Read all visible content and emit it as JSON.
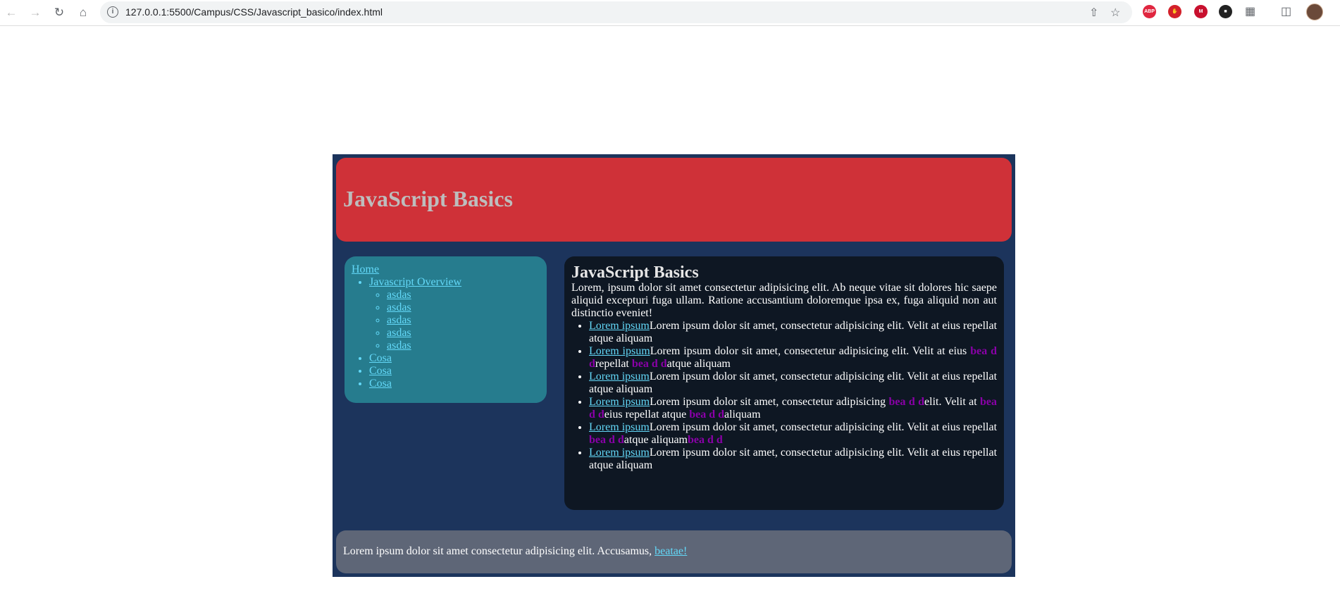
{
  "browser": {
    "url": "127.0.0.1:5500/Campus/CSS/Javascript_basico/index.html"
  },
  "page": {
    "header_title": "JavaScript Basics",
    "sidebar": {
      "home": "Home",
      "overview": "Javascript Overview",
      "subitems": [
        "asdas",
        "asdas",
        "asdas",
        "asdas",
        "asdas"
      ],
      "cosas": [
        "Cosa",
        "Cosa",
        "Cosa"
      ]
    },
    "main": {
      "title": "JavaScript Basics",
      "intro": "Lorem, ipsum dolor sit amet consectetur adipisicing elit. Ab neque vitae sit dolores hic saepe aliquid excepturi fuga ullam. Ratione accusantium doloremque ipsa ex, fuga aliquid non aut distinctio eveniet!",
      "items": [
        {
          "link": "Lorem ipsum",
          "t": [
            "Lorem ipsum dolor sit amet, consectetur adipisicing elit. Velit at eius repellat atque aliquam"
          ],
          "hl": []
        },
        {
          "link": "Lorem ipsum",
          "t": [
            "Lorem ipsum dolor sit amet, consectetur adipisicing elit. Velit at eius ",
            "repellat ",
            "atque aliquam"
          ],
          "hl": [
            "bea d d",
            "bea d d"
          ]
        },
        {
          "link": "Lorem ipsum",
          "t": [
            "Lorem ipsum dolor sit amet, consectetur adipisicing elit. Velit at eius repellat atque aliquam"
          ],
          "hl": []
        },
        {
          "link": "Lorem ipsum",
          "t": [
            "Lorem ipsum dolor sit amet, consectetur adipisicing ",
            "elit. Velit at ",
            "eius repellat atque ",
            "aliquam"
          ],
          "hl": [
            "bea d d",
            "bea d d",
            "bea d d"
          ]
        },
        {
          "link": "Lorem ipsum",
          "t": [
            "Lorem ipsum dolor sit amet, consectetur adipisicing elit. Velit at eius repellat ",
            "atque aliquam",
            ""
          ],
          "hl": [
            "bea d d",
            "bea d d"
          ]
        },
        {
          "link": "Lorem ipsum",
          "t": [
            "Lorem ipsum dolor sit amet, consectetur adipisicing elit. Velit at eius repellat atque aliquam"
          ],
          "hl": []
        }
      ]
    },
    "footer": {
      "text": "Lorem ipsum dolor sit amet consectetur adipisicing elit. Accusamus, ",
      "link": "beatae!"
    }
  },
  "colors": {
    "container_bg": "#1c345c",
    "header_bg": "#cf3138",
    "sidebar_bg": "#267c8e",
    "main_bg": "#0e1723",
    "footer_bg": "#5e6677",
    "link": "#63d8f8",
    "highlight": "#8a00a8"
  }
}
